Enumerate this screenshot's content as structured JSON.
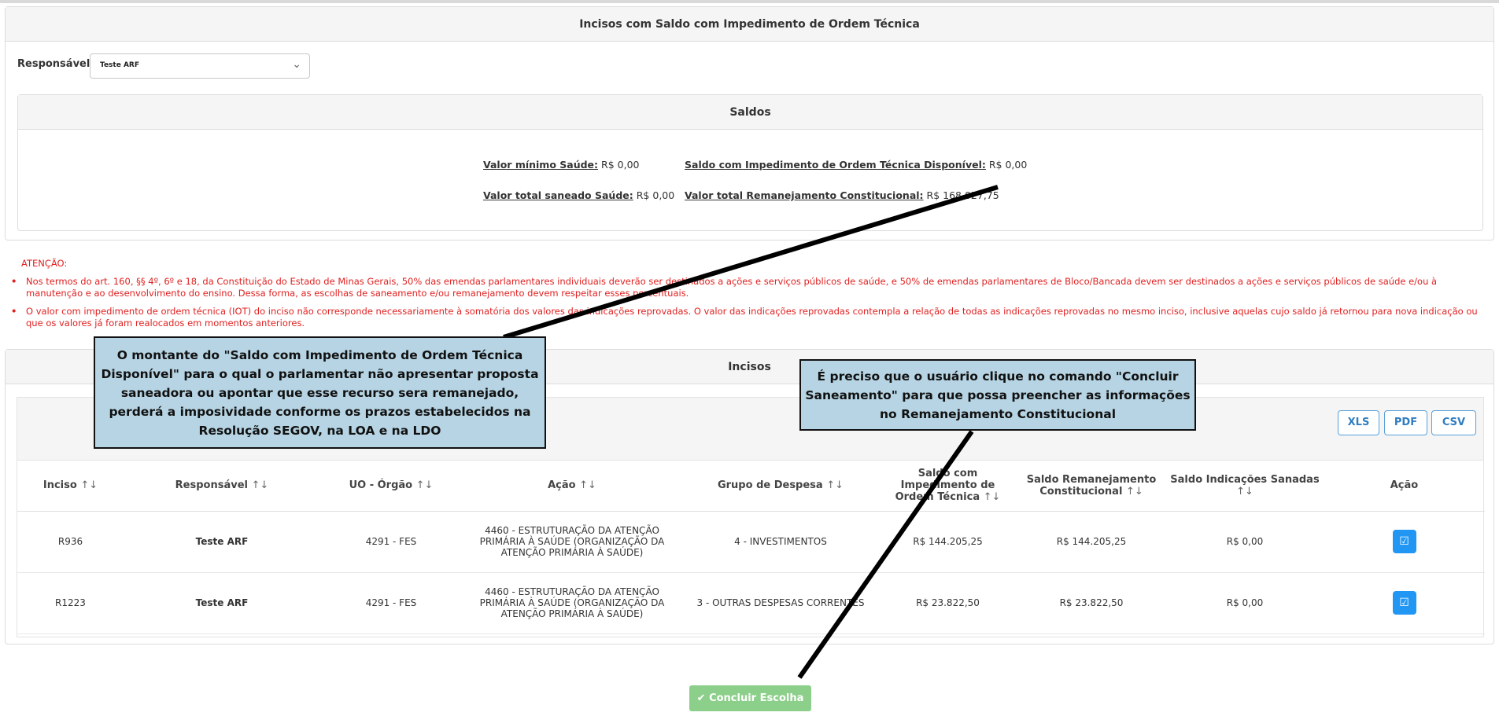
{
  "outer": {
    "title": "Incisos com Saldo com Impedimento de Ordem Técnica"
  },
  "filter": {
    "label": "Responsável:",
    "selected": "Teste ARF"
  },
  "saldos": {
    "title": "Saldos",
    "valor_minimo_label": "Valor mínimo Saúde:",
    "valor_minimo": "R$ 0,00",
    "saldo_iot_label": "Saldo com Impedimento de Ordem Técnica Disponível:",
    "saldo_iot": "R$ 0,00",
    "valor_saneado_label": "Valor total saneado Saúde:",
    "valor_saneado": "R$ 0,00",
    "valor_remanejamento_label": "Valor total Remanejamento Constitucional:",
    "valor_remanejamento": "R$ 168.027,75"
  },
  "attention": {
    "title": "ATENÇÃO:",
    "items": [
      "Nos termos do art. 160, §§ 4º, 6º e 18, da Constituição do Estado de Minas Gerais, 50% das emendas parlamentares individuais deverão ser destinados a ações e serviços públicos de saúde, e 50% de emendas parlamentares de Bloco/Bancada devem ser destinados a ações e serviços públicos de saúde e/ou à manutenção e ao desenvolvimento do ensino. Dessa forma, as escolhas de saneamento e/ou remanejamento devem respeitar esses percentuais.",
      "O valor com impedimento de ordem técnica (IOT) do inciso não corresponde necessariamente à somatória dos valores das indicações reprovadas. O valor das indicações reprovadas contempla a relação de todas as indicações reprovadas no mesmo inciso, inclusive aquelas cujo saldo já retornou para nova indicação ou que os valores já foram realocados em momentos anteriores."
    ]
  },
  "incisos": {
    "title": "Incisos",
    "export": {
      "xls": "XLS",
      "pdf": "PDF",
      "csv": "CSV"
    },
    "sort_icon": "↑↓",
    "columns": {
      "inciso": "Inciso",
      "responsavel": "Responsável",
      "uo": "UO - Órgão",
      "acao": "Ação",
      "grupo": "Grupo de Despesa",
      "saldo_iot": "Saldo com Impedimento de Ordem Técnica",
      "saldo_rem": "Saldo Remanejamento Constitucional",
      "saldo_ind": "Saldo Indicações Sanadas",
      "acoes": "Ação"
    },
    "rows": [
      {
        "inciso": "R936",
        "responsavel": "Teste ARF",
        "uo": "4291 - FES",
        "acao": "4460 - ESTRUTURAÇÃO DA ATENÇÃO PRIMÁRIA À SAÚDE (ORGANIZAÇÃO DA ATENÇÃO PRIMÁRIA À SAÚDE)",
        "grupo": "4 - INVESTIMENTOS",
        "saldo_iot": "R$ 144.205,25",
        "saldo_rem": "R$ 144.205,25",
        "saldo_ind": "R$ 0,00"
      },
      {
        "inciso": "R1223",
        "responsavel": "Teste ARF",
        "uo": "4291 - FES",
        "acao": "4460 - ESTRUTURAÇÃO DA ATENÇÃO PRIMÁRIA À SAÚDE (ORGANIZAÇÃO DA ATENÇÃO PRIMÁRIA À SAÚDE)",
        "grupo": "3 - OUTRAS DESPESAS CORRENTES",
        "saldo_iot": "R$ 23.822,50",
        "saldo_rem": "R$ 23.822,50",
        "saldo_ind": "R$ 0,00"
      }
    ]
  },
  "conclude": {
    "label": "Concluir Escolha",
    "icon": "check-circle-icon"
  },
  "callouts": {
    "one": "O montante do \"Saldo com Impedimento de Ordem Técnica Disponível\" para o qual o parlamentar não apresentar proposta saneadora ou apontar que esse recurso sera remanejado, perderá a imposividade conforme os prazos estabelecidos na Resolução SEGOV, na LOA e na LDO",
    "two": "É preciso que o usuário clique no comando \"Concluir Saneamento\" para que possa preencher as informações no Remanejamento Constitucional"
  },
  "colors": {
    "attention": "#e02020",
    "action_button": "#2196f3",
    "conclude_button": "#8ccf8a",
    "callout_bg": "#b6d4e3"
  }
}
